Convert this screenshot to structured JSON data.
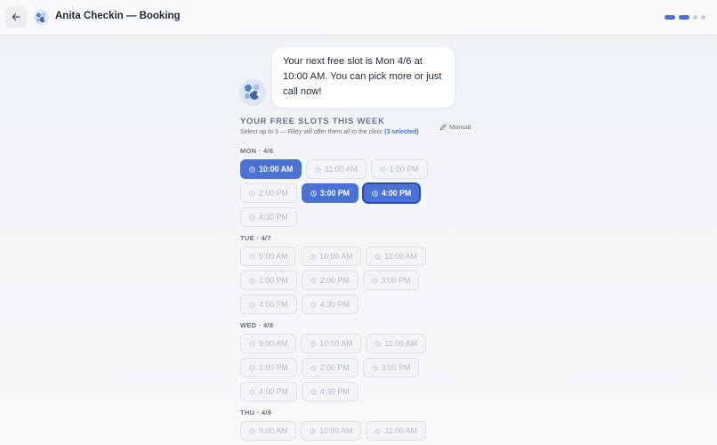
{
  "header": {
    "title": "Anita Checkin — Booking",
    "progress_steps": [
      true,
      true,
      false,
      false
    ],
    "accent": "#4a72d4"
  },
  "chat": {
    "message": "Your next free slot is Mon 4/6 at 10:00 AM. You can pick more or just call now!"
  },
  "slots": {
    "heading": "YOUR FREE SLOTS THIS WEEK",
    "manual_label": "Manual",
    "subtitle": "Select up to 3 — Riley will offer them all to the clinic",
    "selected_count": "(3 selected)",
    "days": [
      {
        "label": "MON · 4/6",
        "times": [
          {
            "time": "10:00 AM",
            "selected": true
          },
          {
            "time": "11:00 AM",
            "selected": false
          },
          {
            "time": "1:00 PM",
            "selected": false
          },
          {
            "time": "2:00 PM",
            "selected": false
          },
          {
            "time": "3:00 PM",
            "selected": true
          },
          {
            "time": "4:00 PM",
            "selected": true,
            "focused": true
          },
          {
            "time": "4:30 PM",
            "selected": false
          }
        ]
      },
      {
        "label": "TUE · 4/7",
        "times": [
          {
            "time": "9:00 AM",
            "selected": false
          },
          {
            "time": "10:00 AM",
            "selected": false
          },
          {
            "time": "11:00 AM",
            "selected": false
          },
          {
            "time": "1:00 PM",
            "selected": false
          },
          {
            "time": "2:00 PM",
            "selected": false
          },
          {
            "time": "3:00 PM",
            "selected": false
          },
          {
            "time": "4:00 PM",
            "selected": false
          },
          {
            "time": "4:30 PM",
            "selected": false
          }
        ]
      },
      {
        "label": "WED · 4/8",
        "times": [
          {
            "time": "9:00 AM",
            "selected": false
          },
          {
            "time": "10:00 AM",
            "selected": false
          },
          {
            "time": "11:00 AM",
            "selected": false
          },
          {
            "time": "1:00 PM",
            "selected": false
          },
          {
            "time": "2:00 PM",
            "selected": false
          },
          {
            "time": "3:00 PM",
            "selected": false
          },
          {
            "time": "4:00 PM",
            "selected": false
          },
          {
            "time": "4:30 PM",
            "selected": false
          }
        ]
      },
      {
        "label": "THU · 4/9",
        "times": [
          {
            "time": "9:00 AM",
            "selected": false
          },
          {
            "time": "10:00 AM",
            "selected": false
          },
          {
            "time": "11:00 AM",
            "selected": false
          }
        ]
      }
    ]
  }
}
